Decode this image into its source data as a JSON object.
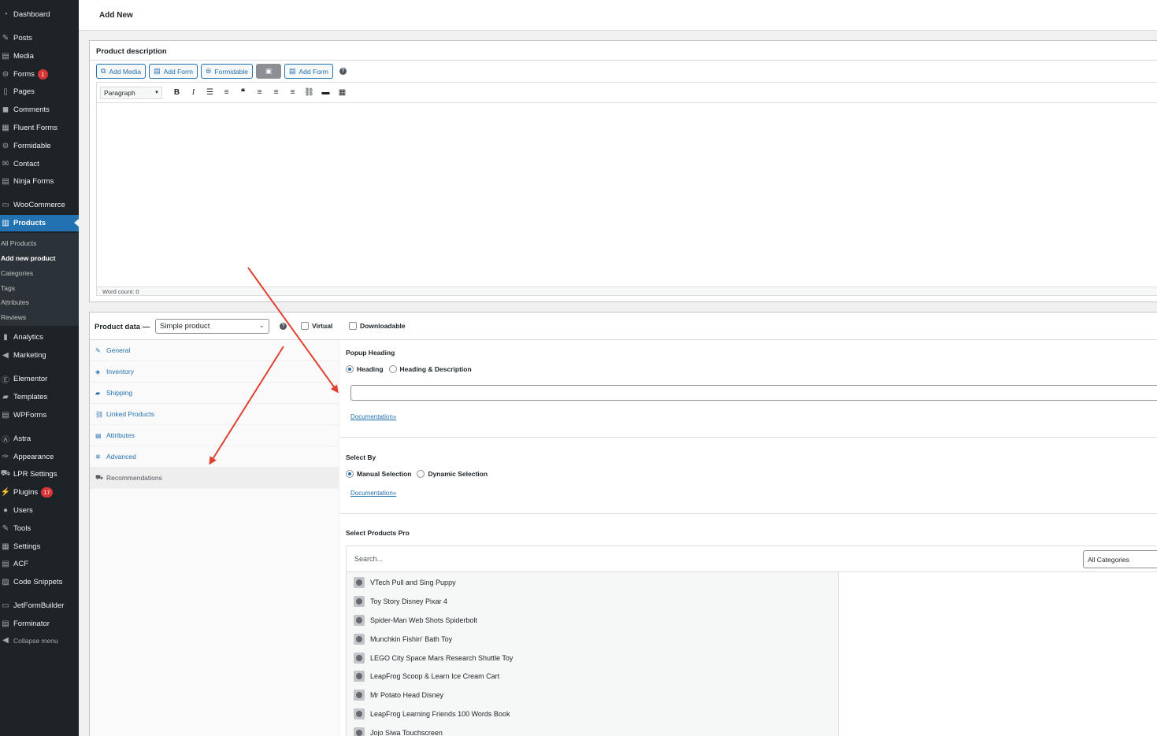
{
  "sidebar": {
    "items": [
      {
        "label": "Dashboard",
        "icon": "dashboard-icon",
        "glyph": "◔"
      },
      {
        "label": "Posts",
        "icon": "pin-icon",
        "glyph": "✎"
      },
      {
        "label": "Media",
        "icon": "media-icon",
        "glyph": "▤"
      },
      {
        "label": "Forms",
        "icon": "forms-icon",
        "glyph": "⊜",
        "badge": "1"
      },
      {
        "label": "Pages",
        "icon": "pages-icon",
        "glyph": "▯"
      },
      {
        "label": "Comments",
        "icon": "comments-icon",
        "glyph": "◼"
      },
      {
        "label": "Fluent Forms",
        "icon": "fluent-forms-icon",
        "glyph": "▦"
      },
      {
        "label": "Formidable",
        "icon": "formidable-icon",
        "glyph": "⊜"
      },
      {
        "label": "Contact",
        "icon": "mail-icon",
        "glyph": "✉"
      },
      {
        "label": "Ninja Forms",
        "icon": "ninja-forms-icon",
        "glyph": "▤"
      },
      {
        "label": "WooCommerce",
        "icon": "woocommerce-icon",
        "glyph": "▭"
      },
      {
        "label": "Products",
        "icon": "products-icon",
        "glyph": "▥"
      },
      {
        "label": "Analytics",
        "icon": "analytics-icon",
        "glyph": "▮"
      },
      {
        "label": "Marketing",
        "icon": "megaphone-icon",
        "glyph": "◀"
      },
      {
        "label": "Elementor",
        "icon": "elementor-icon",
        "glyph": "Ⓔ"
      },
      {
        "label": "Templates",
        "icon": "folder-icon",
        "glyph": "▰"
      },
      {
        "label": "WPForms",
        "icon": "wpforms-icon",
        "glyph": "▤"
      },
      {
        "label": "Astra",
        "icon": "astra-icon",
        "glyph": "Ⓐ"
      },
      {
        "label": "Appearance",
        "icon": "brush-icon",
        "glyph": "✑"
      },
      {
        "label": "LPR Settings",
        "icon": "cart-icon",
        "glyph": "⛟"
      },
      {
        "label": "Plugins",
        "icon": "plugin-icon",
        "glyph": "⚡",
        "badge": "17"
      },
      {
        "label": "Users",
        "icon": "users-icon",
        "glyph": "●"
      },
      {
        "label": "Tools",
        "icon": "wrench-icon",
        "glyph": "✎"
      },
      {
        "label": "Settings",
        "icon": "settings-icon",
        "glyph": "▦"
      },
      {
        "label": "ACF",
        "icon": "acf-icon",
        "glyph": "▤"
      },
      {
        "label": "Code Snippets",
        "icon": "code-snippets-icon",
        "glyph": "▨"
      },
      {
        "label": "JetFormBuilder",
        "icon": "jetformbuilder-icon",
        "glyph": "▭"
      },
      {
        "label": "Forminator",
        "icon": "forminator-icon",
        "glyph": "▤"
      },
      {
        "label": "Collapse menu",
        "icon": "collapse-icon",
        "glyph": "◀"
      }
    ],
    "submenu": [
      "All Products",
      "Add new product",
      "Categories",
      "Tags",
      "Attributes",
      "Reviews"
    ],
    "colors": {
      "bg": "#1d2327",
      "active": "#2271b1",
      "badge": "#d63638"
    }
  },
  "header": {
    "title": "Add New"
  },
  "description": {
    "heading": "Product description",
    "buttons": [
      "Add Media",
      "Add Form",
      "Formidable",
      "Add Form"
    ],
    "format": "Paragraph",
    "toolbar_icons": [
      "bold-icon",
      "italic-icon",
      "bullet-list-icon",
      "numbered-list-icon",
      "blockquote-icon",
      "align-left-icon",
      "align-center-icon",
      "align-right-icon",
      "link-icon",
      "read-more-icon",
      "toolbar-toggle-icon"
    ],
    "word_count": "Word count: 0"
  },
  "product_data": {
    "label": "Product data —",
    "type": "Simple product",
    "virtual": "Virtual",
    "downloadable": "Downloadable",
    "tabs": [
      "General",
      "Inventory",
      "Shipping",
      "Linked Products",
      "Attributes",
      "Advanced",
      "Recommendations"
    ],
    "popup_heading": {
      "title": "Popup Heading",
      "options": [
        "Heading",
        "Heading & Description"
      ],
      "doc": "Documentation»"
    },
    "select_by": {
      "title": "Select By",
      "options": [
        "Manual Selection",
        "Dynamic Selection"
      ],
      "doc": "Documentation»"
    },
    "products_pro": {
      "title": "Select Products Pro",
      "search_placeholder": "Search...",
      "category": "All Categories",
      "items": [
        "VTech Pull and Sing Puppy",
        "Toy Story Disney Pixar 4",
        "Spider-Man Web Shots Spiderbolt",
        "Munchkin Fishin' Bath Toy",
        "LEGO City Space Mars Research Shuttle Toy",
        "LeapFrog Scoop & Learn Ice Cream Cart",
        "Mr Potato Head Disney",
        "LeapFrog Learning Friends 100 Words Book",
        "Jojo Siwa Touchscreen"
      ]
    }
  },
  "annotation": {
    "arrow_color": "#e0412f"
  }
}
